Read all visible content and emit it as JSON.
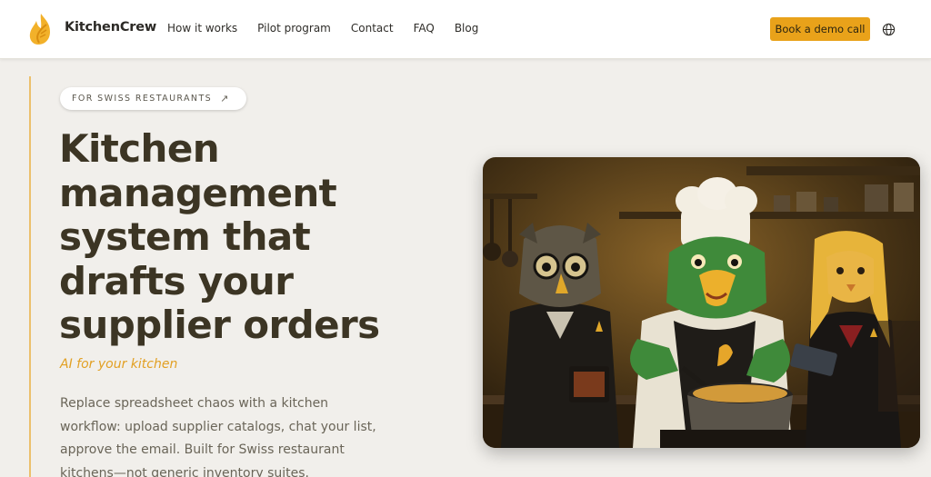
{
  "header": {
    "brand": "KitchenCrew",
    "nav": [
      "How it works",
      "Pilot program",
      "Contact",
      "FAQ",
      "Blog"
    ],
    "cta_label": "Book a demo call"
  },
  "hero": {
    "tag": "FOR SWISS RESTAURANTS",
    "title_lines": [
      "Kitchen",
      "management",
      "system that",
      "drafts your",
      "supplier orders"
    ],
    "subheading": "AI for your kitchen",
    "description_lines": [
      "Replace spreadsheet chaos with a kitchen",
      "workflow: upload supplier catalogs, chat your list,",
      "approve the email. Built for Swiss restaurant",
      "kitchens—not generic inventory suites."
    ]
  },
  "colors": {
    "accent": "#e9a21a",
    "title": "#3c3524",
    "background": "#f1efeb"
  }
}
